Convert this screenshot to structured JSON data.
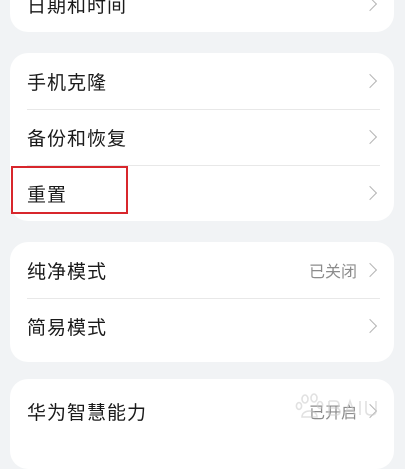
{
  "groups": [
    {
      "items": [
        {
          "label": "日期和时间",
          "value": ""
        }
      ]
    },
    {
      "items": [
        {
          "label": "手机克隆",
          "value": ""
        },
        {
          "label": "备份和恢复",
          "value": ""
        },
        {
          "label": "重置",
          "value": ""
        }
      ]
    },
    {
      "items": [
        {
          "label": "纯净模式",
          "value": "已关闭"
        },
        {
          "label": "简易模式",
          "value": ""
        }
      ]
    },
    {
      "items": [
        {
          "label": "华为智慧能力",
          "value": "已开启"
        }
      ]
    }
  ],
  "colors": {
    "background": "#f1f3f5",
    "card": "#ffffff",
    "highlight_box": "#d8262c",
    "chevron": "#b5b5b5"
  },
  "icons": {
    "row_arrow": "chevron-right-icon"
  }
}
